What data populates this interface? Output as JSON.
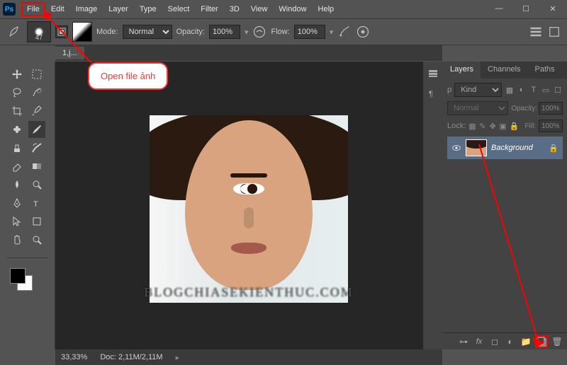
{
  "app": {
    "logo_text": "Ps"
  },
  "menu": {
    "items": [
      "File",
      "Edit",
      "Image",
      "Layer",
      "Type",
      "Select",
      "Filter",
      "3D",
      "View",
      "Window",
      "Help"
    ]
  },
  "window_controls": {
    "minimize": "—",
    "maximize": "☐",
    "close": "✕"
  },
  "options_bar": {
    "brush_size": "47",
    "mode_label": "Mode:",
    "mode_value": "Normal",
    "opacity_label": "Opacity:",
    "opacity_value": "100%",
    "flow_label": "Flow:",
    "flow_value": "100%"
  },
  "document_tab": {
    "label": "1,j..."
  },
  "layers_panel": {
    "tabs": [
      "Layers",
      "Channels",
      "Paths"
    ],
    "filter_label": "Kind",
    "blend_mode": "Normal",
    "opacity_label": "Opacity:",
    "opacity_value": "100%",
    "lock_label": "Lock:",
    "fill_label": "Fill:",
    "fill_value": "100%",
    "layer_name": "Background"
  },
  "status": {
    "zoom": "33,33%",
    "doc_info": "Doc:  2,11M/2,11M"
  },
  "callout": {
    "text": "Open file ảnh"
  },
  "watermark": "BLOGCHIASEKIENTHUC.COM",
  "search_icon": "ρ"
}
